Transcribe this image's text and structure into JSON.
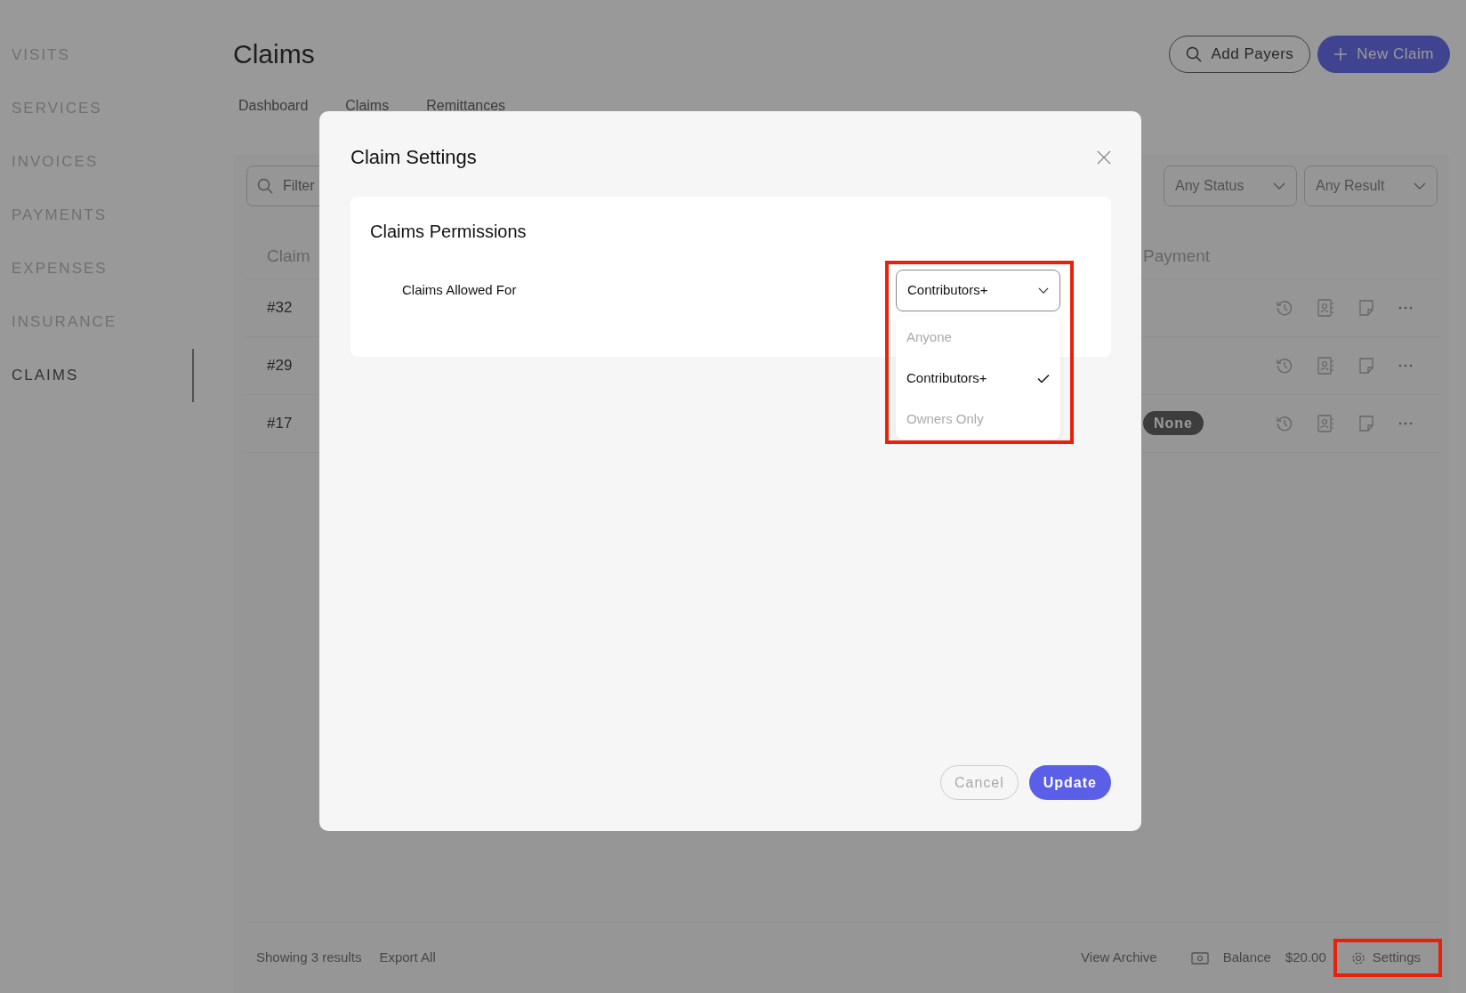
{
  "sidebar": {
    "items": [
      {
        "label": "VISITS",
        "selected": false
      },
      {
        "label": "SERVICES",
        "selected": false
      },
      {
        "label": "INVOICES",
        "selected": false
      },
      {
        "label": "PAYMENTS",
        "selected": false
      },
      {
        "label": "EXPENSES",
        "selected": false
      },
      {
        "label": "INSURANCE",
        "selected": false
      },
      {
        "label": "CLAIMS",
        "selected": true
      }
    ]
  },
  "header": {
    "title": "Claims",
    "buttons": [
      {
        "label": "Add Payers",
        "kind": "search"
      },
      {
        "label": "New Claim",
        "kind": "add"
      }
    ]
  },
  "tabs": [
    {
      "label": "Dashboard"
    },
    {
      "label": "Claims"
    },
    {
      "label": "Remittances"
    }
  ],
  "filter": {
    "placeholder": "Filter"
  },
  "dropdowns": [
    {
      "value": "Any Status"
    },
    {
      "value": "Any Result"
    }
  ],
  "table": {
    "columns": [
      "Claim",
      "Payment"
    ],
    "rows": [
      {
        "claim": "#32"
      },
      {
        "claim": "#29"
      },
      {
        "claim": "#17",
        "payment": "None"
      }
    ]
  },
  "footer": {
    "count": "Showing 3 results",
    "export": "Export All",
    "archive": "View Archive",
    "balance_label": "Balance",
    "balance": "$20.00",
    "settings": {
      "label": "Settings",
      "highlighted": true
    }
  },
  "modal": {
    "title": "Claim Settings",
    "section": {
      "title": "Claims Permissions",
      "field": {
        "label": "Claims Allowed For",
        "value": "Contributors+",
        "expanded": true,
        "highlighted": true,
        "options": [
          {
            "label": "Anyone",
            "selected": false
          },
          {
            "label": "Contributors+",
            "selected": true
          },
          {
            "label": "Owners Only",
            "selected": false
          }
        ]
      }
    },
    "buttons": [
      {
        "label": "Cancel",
        "kind": "secondary"
      },
      {
        "label": "Update",
        "kind": "primary"
      }
    ]
  }
}
